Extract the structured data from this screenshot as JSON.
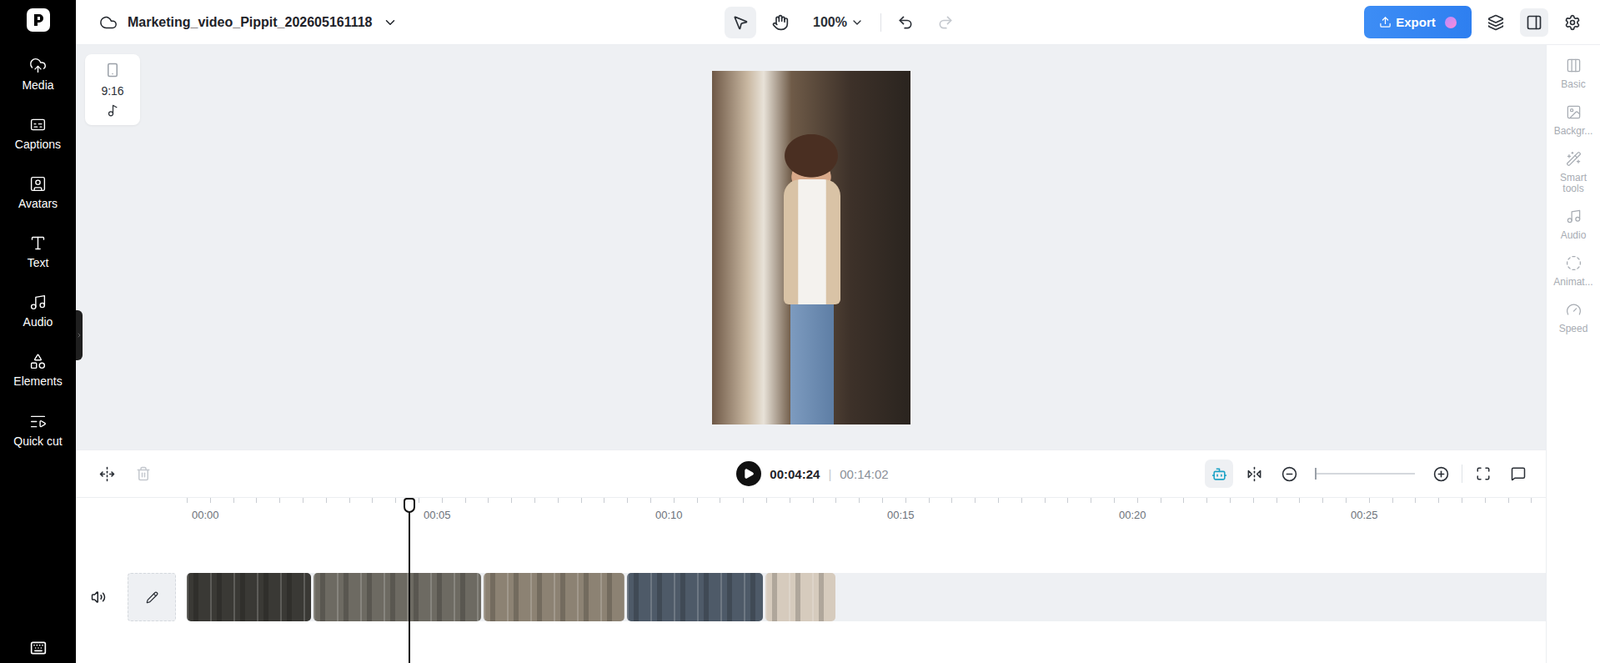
{
  "project": {
    "title": "Marketing_video_Pippit_202605161118"
  },
  "toolbar": {
    "zoom": "100%",
    "select_tool_selected": true,
    "undo_disabled": false,
    "redo_disabled": true
  },
  "export": {
    "label": "Export"
  },
  "sidebar": {
    "items": [
      {
        "label": "Media"
      },
      {
        "label": "Captions"
      },
      {
        "label": "Avatars"
      },
      {
        "label": "Text"
      },
      {
        "label": "Audio"
      },
      {
        "label": "Elements"
      },
      {
        "label": "Quick cut"
      }
    ]
  },
  "aspect": {
    "ratio": "9:16"
  },
  "right_panel": {
    "items": [
      {
        "label": "Basic",
        "disabled": true
      },
      {
        "label": "Backgr...",
        "disabled": true
      },
      {
        "label": "Smart tools",
        "disabled": true
      },
      {
        "label": "Audio",
        "disabled": true
      },
      {
        "label": "Animat...",
        "disabled": true
      },
      {
        "label": "Speed",
        "disabled": true
      }
    ]
  },
  "player": {
    "current": "00:04:24",
    "separator": "|",
    "total": "00:14:02",
    "playing": false,
    "delete_disabled": true,
    "snap_on": true,
    "zoom_level": 0
  },
  "timeline": {
    "ticks": [
      "00:00",
      "00:05",
      "00:10",
      "00:15",
      "00:20",
      "00:25"
    ],
    "playhead": {
      "level": 0.163
    },
    "clips": [
      {
        "color": "#3a3935"
      },
      {
        "color": "#6d6a62"
      },
      {
        "color": "#8c8273"
      },
      {
        "color": "#4e5a68"
      },
      {
        "color": "#d6cbbd"
      }
    ]
  }
}
